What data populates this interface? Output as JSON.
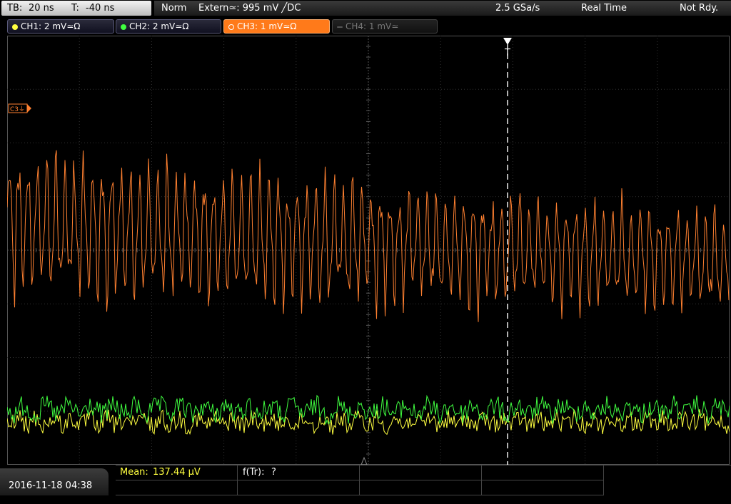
{
  "top": {
    "timebase_label": "TB:",
    "timebase_value": "20 ns",
    "trigger_time_label": "T:",
    "trigger_time_value": "-40 ns",
    "trigger_mode": "Norm",
    "trigger_source": "Extern≃: 995 mV ╱DC",
    "sample_rate": "2.5 GSa/s",
    "acq_mode": "Real Time",
    "state": "Not Rdy."
  },
  "channels": [
    {
      "label": "CH1: 2 mV≃Ω",
      "color": "#ffff40",
      "active": false,
      "enabled": true
    },
    {
      "label": "CH2: 2 mV≃Ω",
      "color": "#40ff40",
      "active": false,
      "enabled": true
    },
    {
      "label": "CH3: 1 mV≃Ω",
      "color": "#ff8030",
      "active": true,
      "enabled": true
    },
    {
      "label": "CH4: 1 mV≃",
      "color": "#888888",
      "active": false,
      "enabled": false
    }
  ],
  "markers": {
    "ch3_ref": "C3⏚",
    "trigger": "T"
  },
  "measurements": {
    "mean_label": "Mean:",
    "mean_value": "137.44 µV",
    "freq_label": "f(Tr):",
    "freq_value": "?"
  },
  "footer": {
    "datetime": "2016-11-18 04:38"
  },
  "colors": {
    "ch1": "#ffff40",
    "ch2": "#40ff40",
    "ch3": "#ff8030",
    "grid": "#3a3a3a",
    "trigger_line": "#ffffff"
  }
}
